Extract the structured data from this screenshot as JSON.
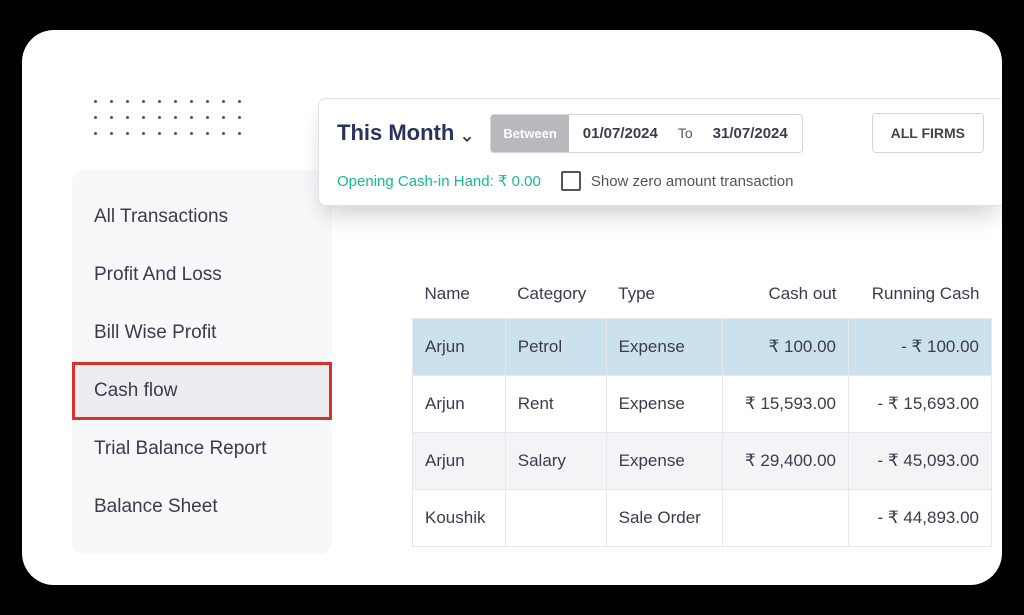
{
  "sidebar": {
    "items": [
      {
        "label": "All Transactions"
      },
      {
        "label": "Profit And Loss"
      },
      {
        "label": "Bill Wise Profit"
      },
      {
        "label": "Cash flow"
      },
      {
        "label": "Trial Balance Report"
      },
      {
        "label": "Balance Sheet"
      }
    ],
    "selected_index": 3
  },
  "filter": {
    "period": "This Month",
    "between_label": "Between",
    "date_from": "01/07/2024",
    "to_label": "To",
    "date_to": "31/07/2024",
    "firms_label": "ALL FIRMS",
    "opening_cash_label": "Opening Cash-in Hand: ₹ 0.00",
    "show_zero_label": "Show zero amount transaction",
    "show_zero_checked": false
  },
  "table": {
    "columns": [
      "Name",
      "Category",
      "Type",
      "Cash out",
      "Running Cash"
    ],
    "rows": [
      {
        "name": "Arjun",
        "category": "Petrol",
        "type": "Expense",
        "cash_out": "₹ 100.00",
        "running": "- ₹ 100.00",
        "highlight": true
      },
      {
        "name": "Arjun",
        "category": "Rent",
        "type": "Expense",
        "cash_out": "₹ 15,593.00",
        "running": "- ₹ 15,693.00",
        "highlight": false
      },
      {
        "name": "Arjun",
        "category": "Salary",
        "type": "Expense",
        "cash_out": "₹ 29,400.00",
        "running": "- ₹ 45,093.00",
        "highlight": false,
        "alt": true
      },
      {
        "name": "Koushik",
        "category": "",
        "type": "Sale Order",
        "cash_out": "",
        "running": "- ₹ 44,893.00",
        "highlight": false
      }
    ]
  }
}
